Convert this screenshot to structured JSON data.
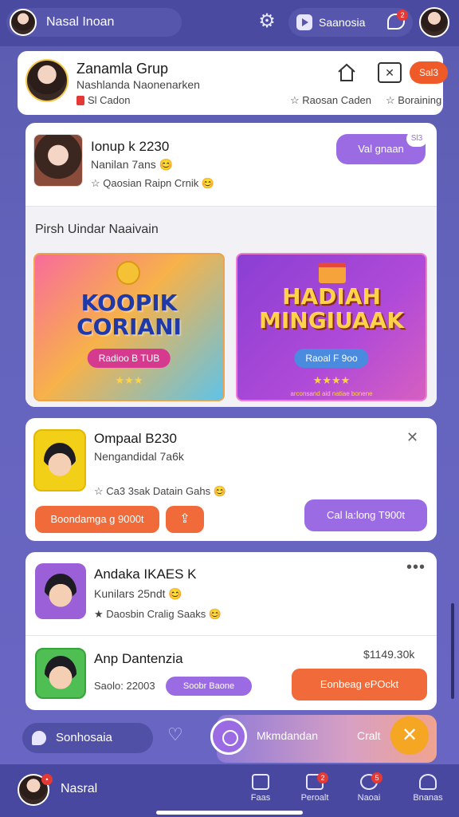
{
  "topbar": {
    "user_name": "Nasal Inoan",
    "search_label": "Saanosia",
    "chat_badge": "2"
  },
  "profile": {
    "title": "Zanamla Grup",
    "subtitle": "Nashlanda Naonenarken",
    "meta": "Sl Cadon",
    "action_badge": "Sal3",
    "right_meta_1": "Raosan Caden",
    "right_meta_2": "Boraining"
  },
  "post1": {
    "title": "Ionup k 2230",
    "subtitle": "Nanilan 7ans",
    "tags": "Qaosian  Raipn  Crnik",
    "button": "Val gnaan",
    "button_badge": "Sl3"
  },
  "section": {
    "title": "Pirsh Uindar Naaivain",
    "promo_a": {
      "headline_1": "KOOPIK",
      "headline_2": "CORIANI",
      "button": "Radioo B TUB",
      "stars": "★★★"
    },
    "promo_b": {
      "headline_1": "HADIAH",
      "headline_2": "MINGIUAAK",
      "button": "Raoal F 9oo",
      "stars": "★★★★",
      "footnote": "arconsand aid natiae bonene"
    }
  },
  "post2": {
    "title": "Ompaal B230",
    "subtitle": "Nengandidal  7a6k",
    "tags": "Ca3 3sak  Datain  Gahs",
    "button_left": "Boondamga g 9000t",
    "button_right": "Cal la:long T900t"
  },
  "post3": {
    "title": "Andaka IKAES K",
    "subtitle": "Kunilars 25ndt",
    "tags": "Daosbin  Cralig Saaks",
    "item_title": "Anp Dantenzia",
    "item_sub": "Saolo: 22003",
    "item_pill": "Soobr Baone",
    "item_price": "$1149.30k",
    "item_button": "Eonbeag ePOckt"
  },
  "bottom_strip": {
    "pill_label": "Sonhosaia",
    "label_1": "Mkmdandan",
    "label_2": "Cralt"
  },
  "tabbar": {
    "name": "Nasral",
    "tabs": [
      {
        "label": "Faas"
      },
      {
        "label": "Peroalt",
        "badge": "2"
      },
      {
        "label": "Naoai",
        "badge": "5"
      },
      {
        "label": "Bnanas"
      }
    ]
  }
}
